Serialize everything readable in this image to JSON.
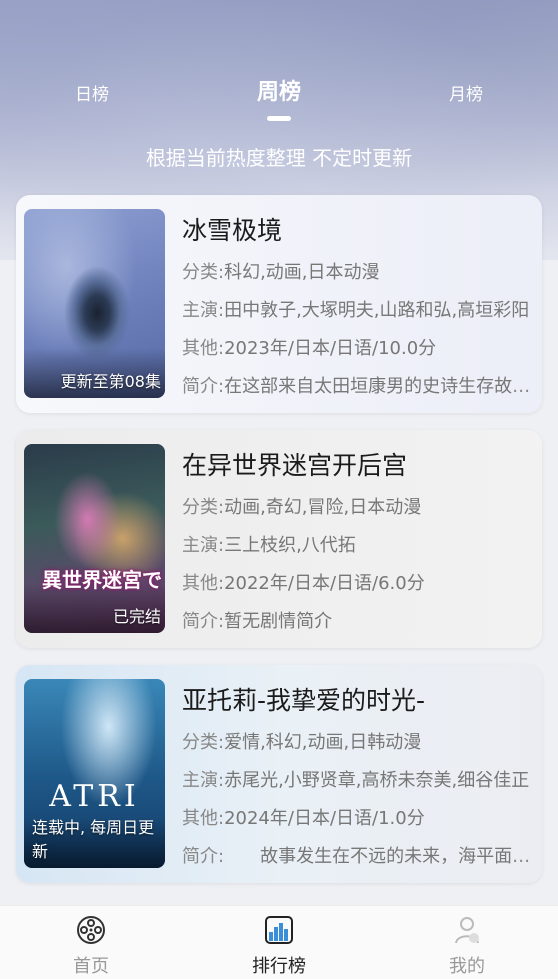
{
  "tabs": {
    "day": "日榜",
    "week": "周榜",
    "month": "月榜",
    "active": "week"
  },
  "subtitle": "根据当前热度整理 不定时更新",
  "labels": {
    "category": "分类:",
    "cast": "主演:",
    "other": "其他:",
    "intro": "简介:"
  },
  "cards": [
    {
      "title": "冰雪极境",
      "badge": "更新至第08集",
      "category": "科幻,动画,日本动漫",
      "cast": "田中敦子,大塚明夫,山路和弘,高垣彩阳",
      "other": "2023年/日本/日语/10.0分",
      "intro": "在这部来自太田垣康男的史诗生存故事中"
    },
    {
      "title": "在异世界迷宫开后宫",
      "badge": "已完结",
      "poster_text": "異世界迷宮で",
      "category": "动画,奇幻,冒险,日本动漫",
      "cast": "三上枝织,八代拓",
      "other": "2022年/日本/日语/6.0分",
      "intro": "暂无剧情简介"
    },
    {
      "title": "亚托莉-我挚爱的时光-",
      "badge": "连载中, 每周日更新",
      "poster_text": "ATRI",
      "category": "爱情,科幻,动画,日韩动漫",
      "cast": "赤尾光,小野贤章,高桥未奈美,细谷佳正",
      "other": "2024年/日本/日语/1.0分",
      "intro": "　　故事发生在不远的未来，海平面上升"
    }
  ],
  "nav": {
    "home": "首页",
    "rank": "排行榜",
    "mine": "我的",
    "active": "rank"
  },
  "colors": {
    "accent": "#3a8fd8",
    "text": "#1b1b1b",
    "muted": "#888888"
  }
}
